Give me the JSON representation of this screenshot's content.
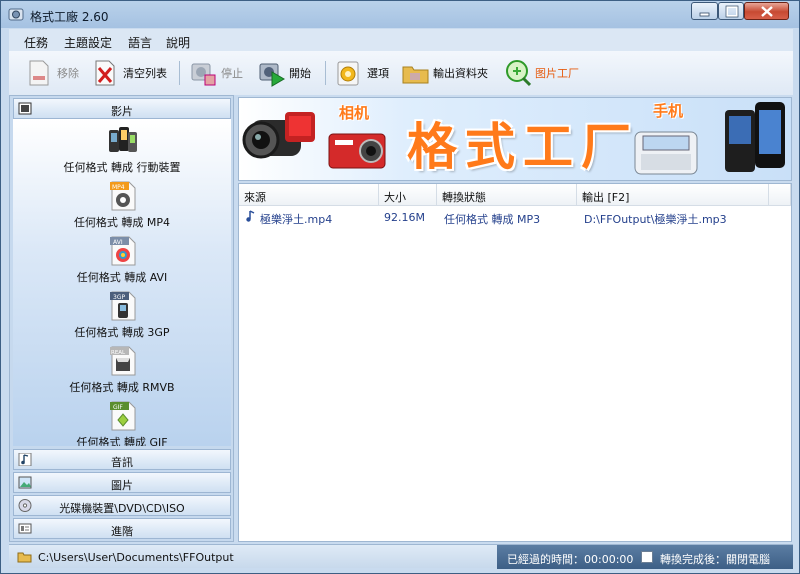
{
  "window": {
    "title": "格式工廠 2.60"
  },
  "menu": [
    "任務",
    "主題設定",
    "語言",
    "說明"
  ],
  "toolbar": {
    "remove": "移除",
    "clear": "清空列表",
    "stop": "停止",
    "start": "開始",
    "options": "選項",
    "output_folder": "輸出資料夾",
    "picture_factory": "图片工厂"
  },
  "sidebar": {
    "video": "影片",
    "video_items": [
      "任何格式 轉成 行動裝置",
      "任何格式 轉成 MP4",
      "任何格式 轉成 AVI",
      "任何格式 轉成 3GP",
      "任何格式 轉成 RMVB",
      "任何格式 轉成 GIF"
    ],
    "video_badges": [
      "MP4",
      "AVI",
      "3GP",
      "REAL",
      "GIF"
    ],
    "audio": "音訊",
    "picture": "圖片",
    "rom": "光碟機裝置\\DVD\\CD\\ISO",
    "advanced": "進階"
  },
  "banner": {
    "title": "格式工厂",
    "camera": "相机",
    "phone": "手机"
  },
  "filelist": {
    "columns": [
      "來源",
      "大小",
      "轉換狀態",
      "輸出 [F2]"
    ],
    "rows": [
      {
        "source": "極樂淨土.mp4",
        "size": "92.16M",
        "status": "任何格式 轉成 MP3",
        "output": "D:\\FFOutput\\極樂淨土.mp3"
      }
    ]
  },
  "status": {
    "path": "C:\\Users\\User\\Documents\\FFOutput",
    "elapsed": "已經過的時間：00:00:00",
    "after": "轉換完成後：關閉電腦"
  },
  "colors": {
    "accent": "#ff7a1a",
    "link_text": "#24408c"
  }
}
